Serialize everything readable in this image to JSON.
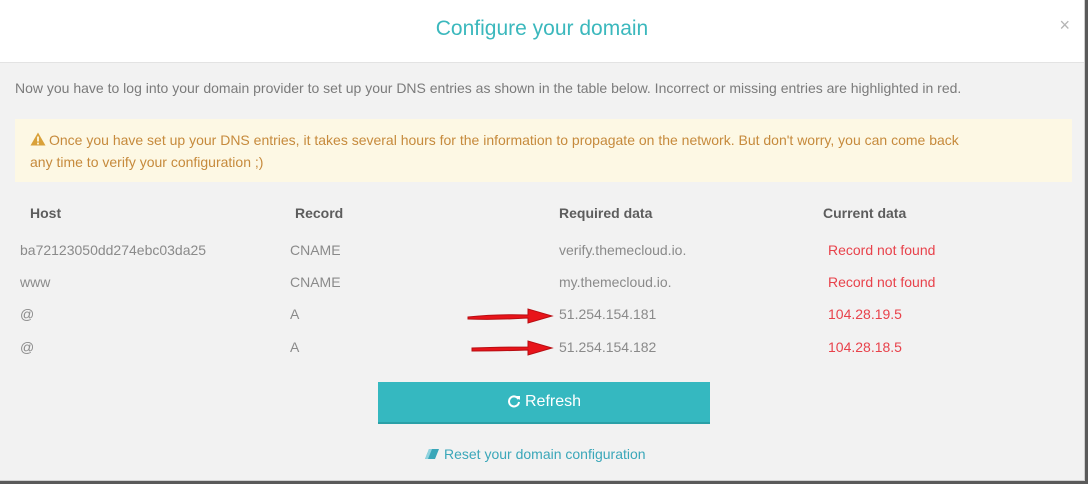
{
  "dialog": {
    "title": "Configure your domain",
    "close_label": "×"
  },
  "intro_text": "Now you have to log into your domain provider to set up your DNS entries as shown in the table below. Incorrect or missing entries are highlighted in red.",
  "warning": {
    "icon": "warning-triangle-icon",
    "line1": "Once you have set up your DNS entries, it takes several hours for the information to propagate on the network. But don't worry, you can come back",
    "line2": "any time to verify your configuration ;)"
  },
  "table": {
    "headers": [
      "Host",
      "Record",
      "Required data",
      "Current data"
    ],
    "rows": [
      {
        "host": "ba72123050dd274ebc03da25",
        "record": "CNAME",
        "required": "verify.themecloud.io.",
        "current": "Record not found"
      },
      {
        "host": "www",
        "record": "CNAME",
        "required": "my.themecloud.io.",
        "current": "Record not found"
      },
      {
        "host": "@",
        "record": "A",
        "required": "51.254.154.181",
        "current": "104.28.19.5"
      },
      {
        "host": "@",
        "record": "A",
        "required": "51.254.154.182",
        "current": "104.28.18.5"
      }
    ]
  },
  "actions": {
    "refresh_label": "Refresh",
    "reset_label": "Reset your domain configuration"
  },
  "colors": {
    "accent": "#35b8c0",
    "title": "#3bb8bd",
    "error": "#e8424b",
    "warning_bg": "#fdf8e4",
    "warning_text": "#c68a3c",
    "annotation_arrow": "#e8141a"
  }
}
